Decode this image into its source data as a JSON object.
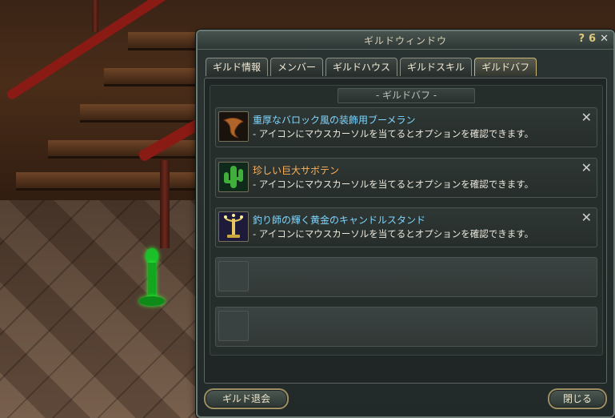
{
  "window": {
    "title": "ギルドウィンドウ",
    "help_icon": "?",
    "lock_icon": "6",
    "close_icon": "✕"
  },
  "tabs": [
    {
      "label": "ギルド情報",
      "active": false
    },
    {
      "label": "メンバー",
      "active": false
    },
    {
      "label": "ギルドハウス",
      "active": false
    },
    {
      "label": "ギルドスキル",
      "active": false
    },
    {
      "label": "ギルドバフ",
      "active": true
    }
  ],
  "section_label": "- ギルドバフ -",
  "buffs": [
    {
      "name": "重厚なバロック風の装飾用ブーメラン",
      "name_color": "#7fd6ff",
      "desc": "- アイコンにマウスカーソルを当てるとオプションを確認できます。",
      "icon": "boomerang-icon"
    },
    {
      "name": "珍しい巨大サボテン",
      "name_color": "#ffb25a",
      "desc": "- アイコンにマウスカーソルを当てるとオプションを確認できます。",
      "icon": "cactus-icon"
    },
    {
      "name": "釣り師の輝く黄金のキャンドルスタンド",
      "name_color": "#7fd6ff",
      "desc": "- アイコンにマウスカーソルを当てるとオプションを確認できます。",
      "icon": "candlestand-icon"
    }
  ],
  "remove_icon": "✕",
  "buttons": {
    "leave_guild": "ギルド退会",
    "close": "閉じる"
  },
  "colors": {
    "accent_gold": "#9c8f63",
    "uncommon_name": "#7fd6ff",
    "rare_name": "#ffb25a"
  }
}
